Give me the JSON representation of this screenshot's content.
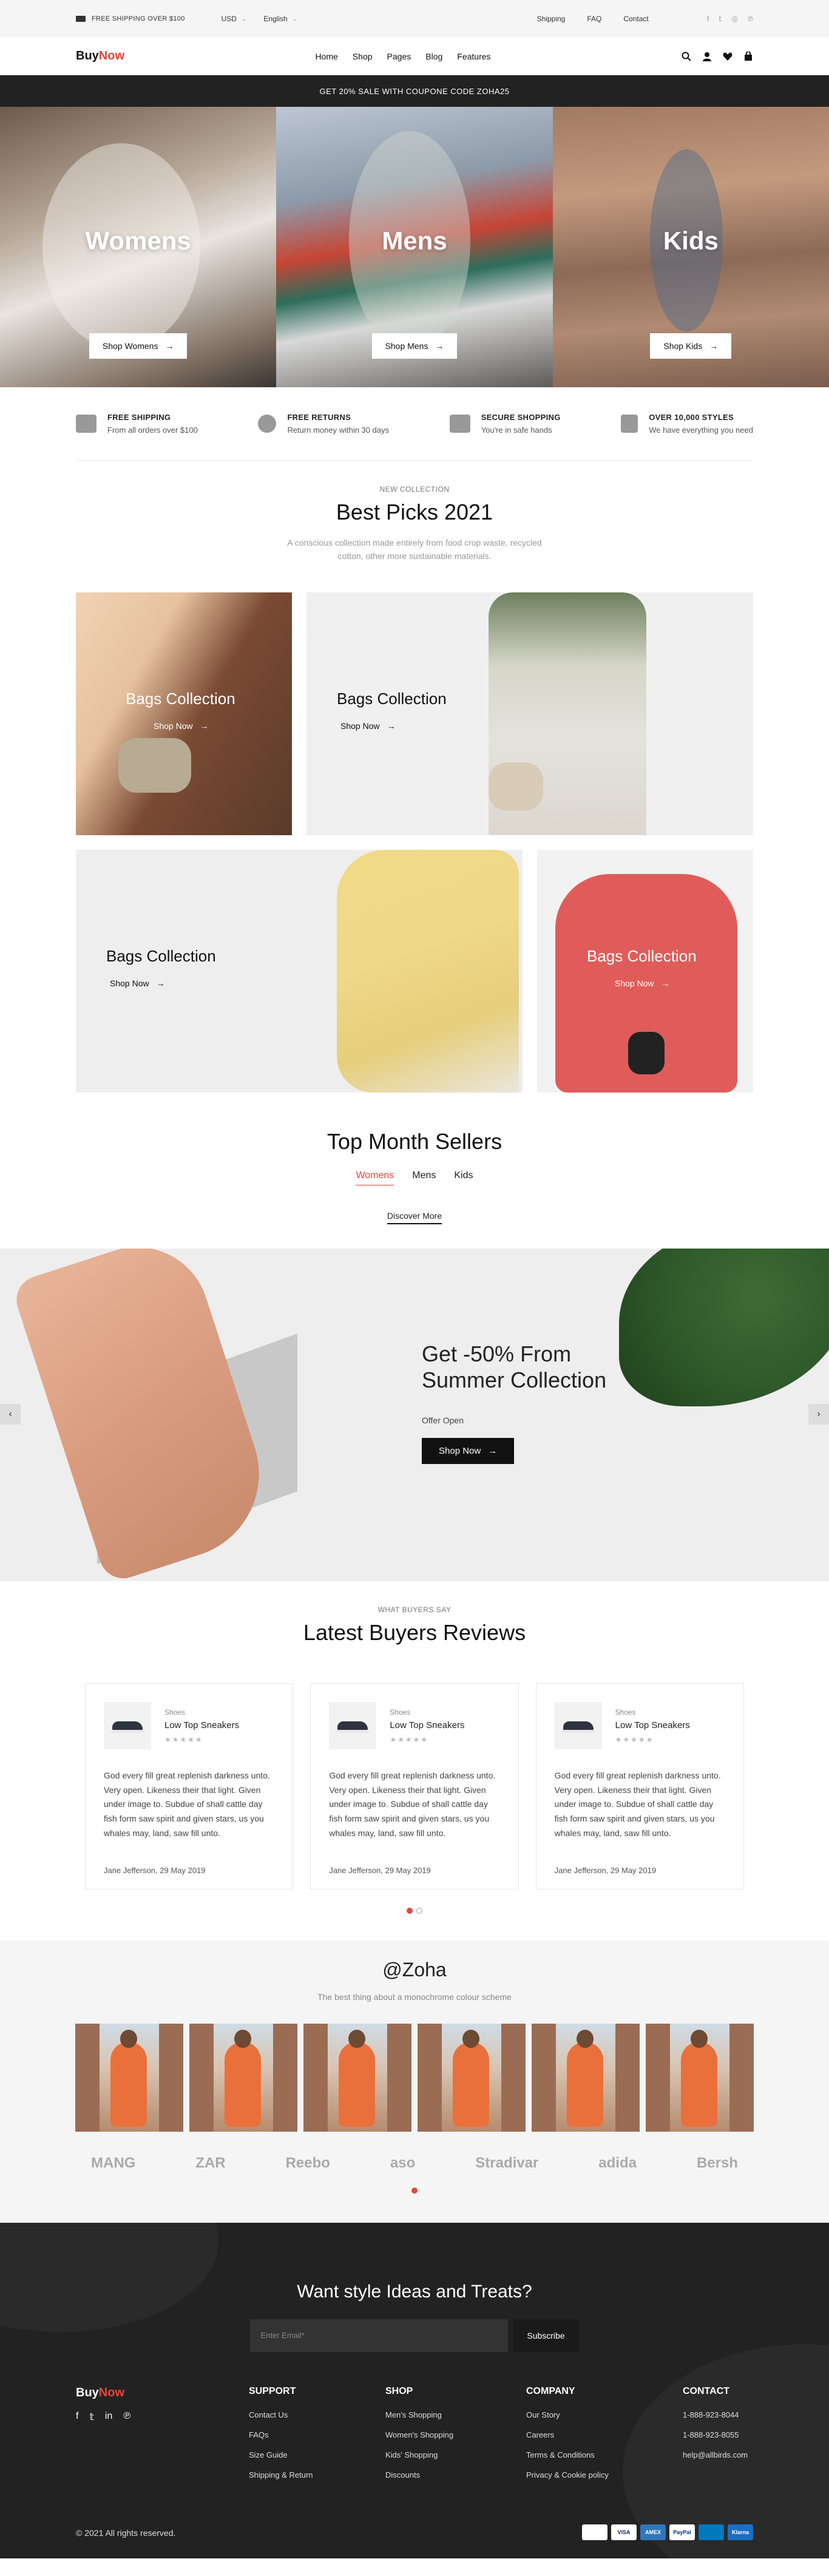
{
  "topbar": {
    "shipping": "FREE SHIPPING OVER $100",
    "currency": "USD",
    "language": "English",
    "links": [
      "Shipping",
      "FAQ",
      "Contact"
    ],
    "social": [
      "f",
      "t",
      "ig",
      "p"
    ]
  },
  "header": {
    "logo_buy": "Buy",
    "logo_now": "Now",
    "nav": [
      "Home",
      "Shop",
      "Pages",
      "Blog",
      "Features"
    ]
  },
  "promo": "GET 20% SALE WITH COUPONE CODE ZOHA25",
  "hero": [
    {
      "title": "Womens",
      "cta": "Shop Womens"
    },
    {
      "title": "Mens",
      "cta": "Shop Mens"
    },
    {
      "title": "Kids",
      "cta": "Shop Kids"
    }
  ],
  "features": [
    {
      "title": "FREE SHIPPING",
      "sub": "From all orders over $100"
    },
    {
      "title": "FREE RETURNS",
      "sub": "Return money within 30 days"
    },
    {
      "title": "SECURE SHOPPING",
      "sub": "You're in safe hands"
    },
    {
      "title": "OVER 10,000 STYLES",
      "sub": "We have everything you need"
    }
  ],
  "collection": {
    "eyebrow": "NEW COLLECTION",
    "title": "Best Picks 2021",
    "lead_line1": "A conscious collection made entirely from food crop waste, recycled",
    "lead_line2": "cotton, other more sustainable materials.",
    "cards": [
      {
        "title": "Bags Collection",
        "cta": "Shop Now"
      },
      {
        "title": "Bags Collection",
        "cta": "Shop Now"
      },
      {
        "title": "Bags Collection",
        "cta": "Shop Now"
      },
      {
        "title": "Bags Collection",
        "cta": "Shop Now"
      }
    ]
  },
  "sellers": {
    "title": "Top Month Sellers",
    "tabs": [
      "Womens",
      "Mens",
      "Kids"
    ],
    "discover": "Discover More"
  },
  "summer": {
    "title_line1": "Get -50% From",
    "title_line2": "Summer Collection",
    "offer": "Offer Open",
    "cta": "Shop Now"
  },
  "reviews": {
    "eyebrow": "WHAT BUYERS SAY",
    "title": "Latest Buyers Reviews",
    "items": [
      {
        "category": "Shoes",
        "product": "Low Top Sneakers",
        "text": "God every fill great replenish darkness unto. Very open. Likeness their that light. Given under image to. Subdue of shall cattle day fish form saw spirit and given stars, us you whales may, land, saw fill unto.",
        "author": "Jane Jefferson, 29 May 2019"
      },
      {
        "category": "Shoes",
        "product": "Low Top Sneakers",
        "text": "God every fill great replenish darkness unto. Very open. Likeness their that light. Given under image to. Subdue of shall cattle day fish form saw spirit and given stars, us you whales may, land, saw fill unto.",
        "author": "Jane Jefferson, 29 May 2019"
      },
      {
        "category": "Shoes",
        "product": "Low Top Sneakers",
        "text": "God every fill great replenish darkness unto. Very open. Likeness their that light. Given under image to. Subdue of shall cattle day fish form saw spirit and given stars, us you whales may, land, saw fill unto.",
        "author": "Jane Jefferson, 29 May 2019"
      }
    ]
  },
  "instagram": {
    "handle": "@Zoha",
    "tagline": "The best thing about a monochrome colour scheme",
    "brands": [
      "MANG",
      "ZAR",
      "Reebo",
      "aso",
      "Stradivar",
      "adida",
      "Bersh"
    ]
  },
  "footer": {
    "newsletter_title": "Want style Ideas and Treats?",
    "email_placeholder": "Enter Email*",
    "subscribe": "Subscribe",
    "columns": [
      {
        "title": "SUPPORT",
        "links": [
          "Contact Us",
          "FAQs",
          "Size Guide",
          "Shipping & Return"
        ]
      },
      {
        "title": "SHOP",
        "links": [
          "Men's Shopping",
          "Women's Shopping",
          "Kids' Shopping",
          "Discounts"
        ]
      },
      {
        "title": "COMPANY",
        "links": [
          "Our Story",
          "Careers",
          "Terms & Conditions",
          "Privacy & Cookie policy"
        ]
      },
      {
        "title": "CONTACT",
        "links": [
          "1-888-923-8044",
          "1-888-923-8055",
          "help@allbirds.com"
        ]
      }
    ],
    "copyright": "© 2021 All rights reserved.",
    "payments": [
      "",
      "VISA",
      "AMEX",
      "PayPal",
      "",
      "Klarna"
    ]
  },
  "colors": {
    "accent": "#e5473a",
    "dark": "#222222"
  }
}
